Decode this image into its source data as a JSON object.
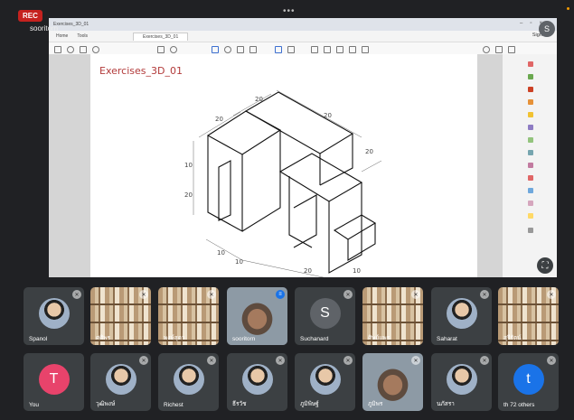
{
  "meeting": {
    "rec_label": "REC",
    "presenter_label": "sooritorn",
    "top_avatar_letter": "S"
  },
  "shared_screen": {
    "window_title": "Exercises_3D_01",
    "menu": [
      "Home",
      "Tools"
    ],
    "tab_label": "Exercises_3D_01",
    "sign_in": "Sign In",
    "page_title": "Exercises_3D_01",
    "fullscreen_icon": "fit-screen-icon"
  },
  "participants": [
    {
      "name": "Spanol",
      "type": "photo"
    },
    {
      "name": "ศศิพร",
      "type": "shelf"
    },
    {
      "name": "พงษ์สุดา",
      "type": "shelf"
    },
    {
      "name": "sooritorn",
      "type": "camera",
      "speaking": true
    },
    {
      "name": "Suchanard",
      "type": "letter",
      "letter": "S",
      "color": "#5f6368"
    },
    {
      "name": "ศิษย์แพร",
      "type": "shelf"
    },
    {
      "name": "Saharat",
      "type": "photo"
    },
    {
      "name": "สุรีรัตน์",
      "type": "shelf"
    },
    {
      "name": "You",
      "type": "letter",
      "letter": "T",
      "color": "#e8436b"
    },
    {
      "name": "วุฒิพงษ์",
      "type": "photo"
    },
    {
      "name": "Richest",
      "type": "photo"
    },
    {
      "name": "ธีรวัช",
      "type": "photo"
    },
    {
      "name": "ภูมิพิษฐ์",
      "type": "photo"
    },
    {
      "name": "ภูมิพร",
      "type": "camera"
    },
    {
      "name": "นภัสรา",
      "type": "photo"
    },
    {
      "name": "th  72 others",
      "type": "letter",
      "letter": "t",
      "color": "#1a73e8"
    }
  ]
}
